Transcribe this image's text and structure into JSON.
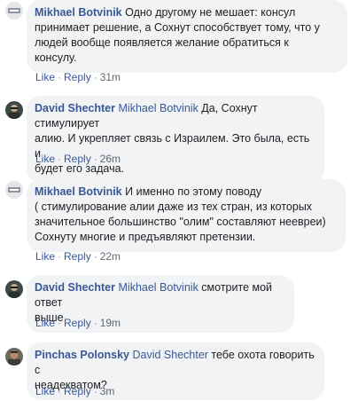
{
  "comments": [
    {
      "author": "Mikhael Botvinik",
      "tag": "",
      "lines": [
        "Одно другому не мешает: консул",
        "принимает решение, а Сохнут способствует тому, что у",
        "людей вообще появляется желание обратиться к",
        "консулу."
      ],
      "like": "Like",
      "reply": "Reply",
      "time": "31m"
    },
    {
      "author": "David Shechter",
      "tag": "Mikhael Botvinik",
      "lines": [
        " Да, Сохнут стимулирует",
        "алию. И укрепляет связь с Израилем. Это была, есть и",
        "будет его задача."
      ],
      "like": "Like",
      "reply": "Reply",
      "time": "26m"
    },
    {
      "author": "Mikhael Botvinik",
      "tag": "",
      "lines": [
        "И именно по этому поводу",
        "( стимулирование алии даже из тех стран, из которых",
        "значительное большинство \"олим\" составляют неевреи)",
        "Сохнуту многие и предъявляют претензии."
      ],
      "like": "Like",
      "reply": "Reply",
      "time": "22m"
    },
    {
      "author": "David Shechter",
      "tag": "Mikhael Botvinik",
      "lines": [
        " смотрите мой ответ",
        "выше"
      ],
      "like": "Like",
      "reply": "Reply",
      "time": "19m"
    },
    {
      "author": "Pinchas Polonsky",
      "tag": "David Shechter",
      "lines": [
        " тебе охота говорить с",
        "неадекватом?"
      ],
      "like": "Like",
      "reply": "Reply",
      "time": "3m"
    }
  ]
}
